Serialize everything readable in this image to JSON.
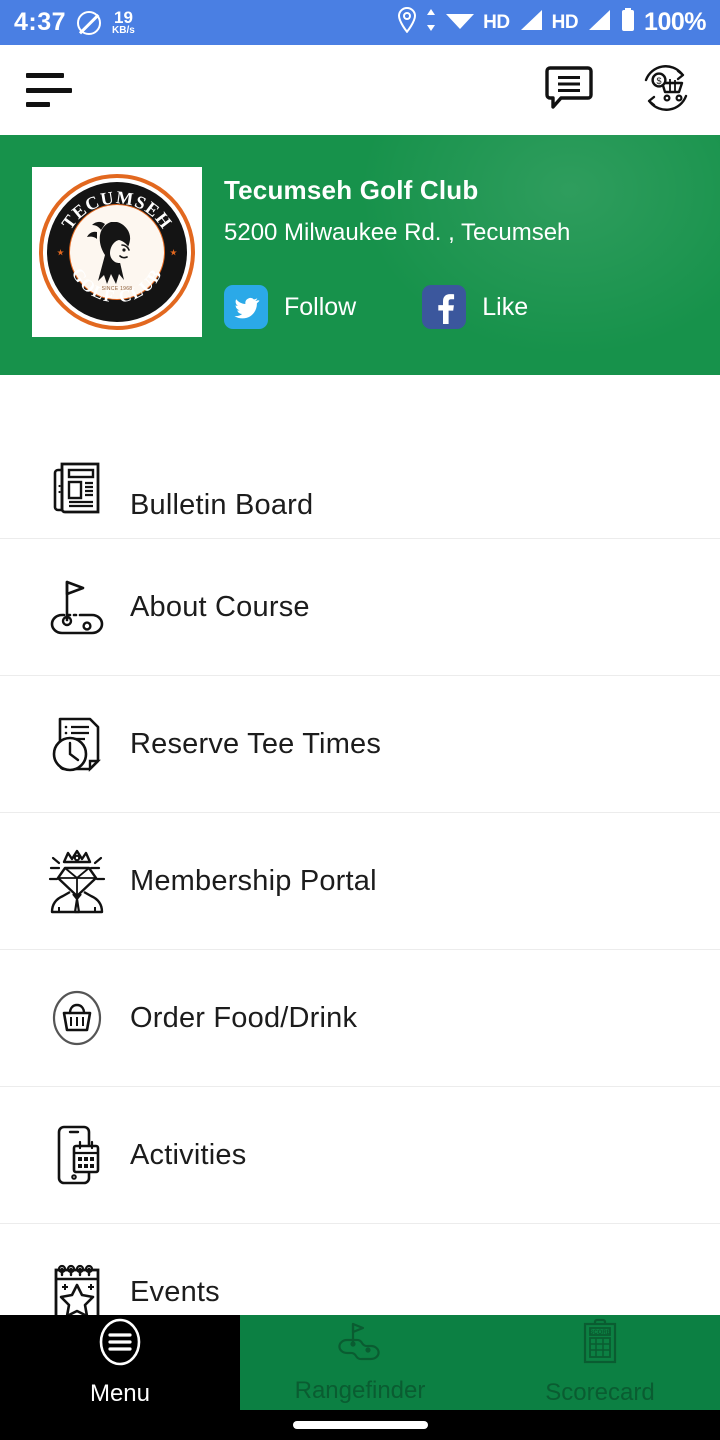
{
  "status_bar": {
    "time": "4:37",
    "dnd_icon": "do-not-disturb-icon",
    "data_rate_value": "19",
    "data_rate_unit": "KB/s",
    "location_icon": "location-pin-icon",
    "wifi_icon": "wifi-icon",
    "wifi_hd_label": "HD",
    "signal1_icon": "signal-bars-icon",
    "signal1_hd_label": "HD",
    "signal2_icon": "signal-bars-icon",
    "battery_icon": "battery-icon",
    "battery_label": "100%",
    "background_color": "#4a7fe3"
  },
  "app_bar": {
    "menu_icon": "hamburger-menu-icon",
    "messages_icon": "chat-bubble-icon",
    "reorder_icon": "cart-refresh-dollar-icon"
  },
  "club": {
    "name": "Tecumseh Golf Club",
    "address": "5200 Milwaukee Rd. , Tecumseh",
    "logo": {
      "arc_top_text": "TECUMSEH",
      "arc_bottom_text": "GOLF CLUB",
      "since_text": "SINCE 1968",
      "ring_color": "#e2681f",
      "disc_color": "#141414"
    },
    "header_color": "#17924b",
    "social": [
      {
        "label": "Follow",
        "network": "twitter",
        "icon": "twitter-icon",
        "color": "#2ba9e8"
      },
      {
        "label": "Like",
        "network": "facebook",
        "icon": "facebook-icon",
        "color": "#3b579d"
      }
    ]
  },
  "menu": {
    "items": [
      {
        "label": "Bulletin Board",
        "icon": "newspaper-icon"
      },
      {
        "label": "About Course",
        "icon": "golf-flag-green-icon"
      },
      {
        "label": "Reserve Tee Times",
        "icon": "document-clock-icon"
      },
      {
        "label": "Membership Portal",
        "icon": "crowned-diamond-member-icon"
      },
      {
        "label": "Order Food/Drink",
        "icon": "shopping-basket-circle-icon"
      },
      {
        "label": "Activities",
        "icon": "phone-calendar-icon"
      },
      {
        "label": "Events",
        "icon": "calendar-star-icon"
      }
    ]
  },
  "bottom_nav": {
    "tabs": [
      {
        "label": "Menu",
        "icon": "circle-hamburger-icon",
        "active": true,
        "background": "#000000"
      },
      {
        "label": "Rangefinder",
        "icon": "golf-green-flag-icon",
        "active": false,
        "background": "#0c8043"
      },
      {
        "label": "Scorecard",
        "icon": "clipboard-score-icon",
        "active": false,
        "background": "#0c8043"
      }
    ],
    "scorecard_icon_text": "SCORE"
  },
  "system_nav": {
    "gesture_pill": "home-gesture-pill"
  }
}
